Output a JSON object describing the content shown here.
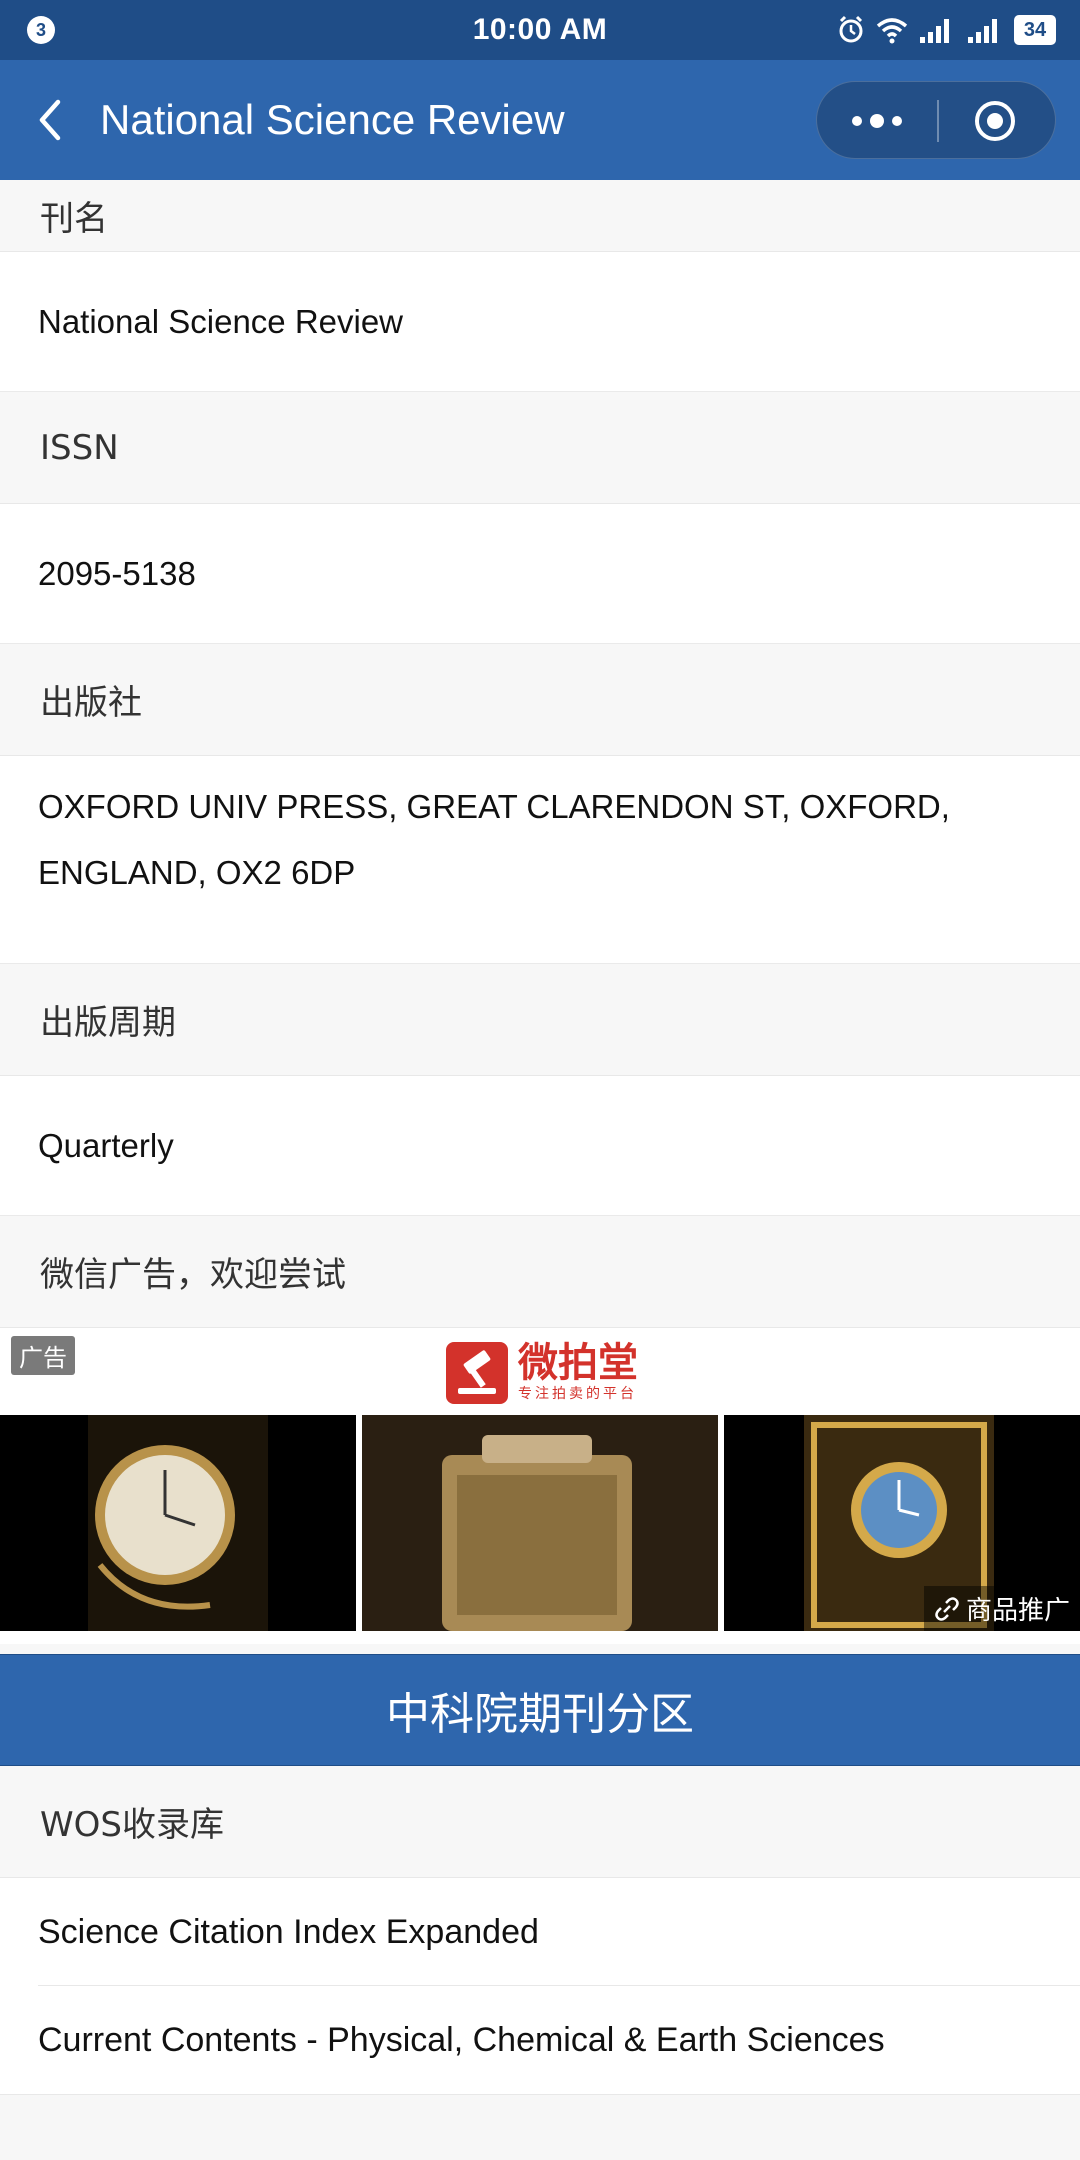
{
  "status_bar": {
    "notification_count": "3",
    "time": "10:00 AM",
    "battery": "34"
  },
  "nav": {
    "title": "National Science Review"
  },
  "fields": [
    {
      "label": "刊名",
      "value": "National Science Review"
    },
    {
      "label": "ISSN",
      "value": "2095-5138"
    },
    {
      "label": "出版社",
      "value": "OXFORD UNIV PRESS, GREAT CLARENDON ST, OXFORD, ENGLAND, OX2 6DP"
    },
    {
      "label": "出版周期",
      "value": "Quarterly"
    }
  ],
  "ad": {
    "section_label": "微信广告，欢迎尝试",
    "tag": "广告",
    "brand_name": "微拍堂",
    "brand_tagline": "专注拍卖的平台",
    "promo_label": "商品推广"
  },
  "cas_button": "中科院期刊分区",
  "wos": {
    "label": "WOS收录库",
    "items": [
      "Science Citation Index Expanded",
      "Current Contents - Physical, Chemical & Earth Sciences"
    ]
  },
  "colors": {
    "nav_blue": "#2e66ad",
    "status_blue": "#1f4d87",
    "brand_red": "#d3322b"
  }
}
